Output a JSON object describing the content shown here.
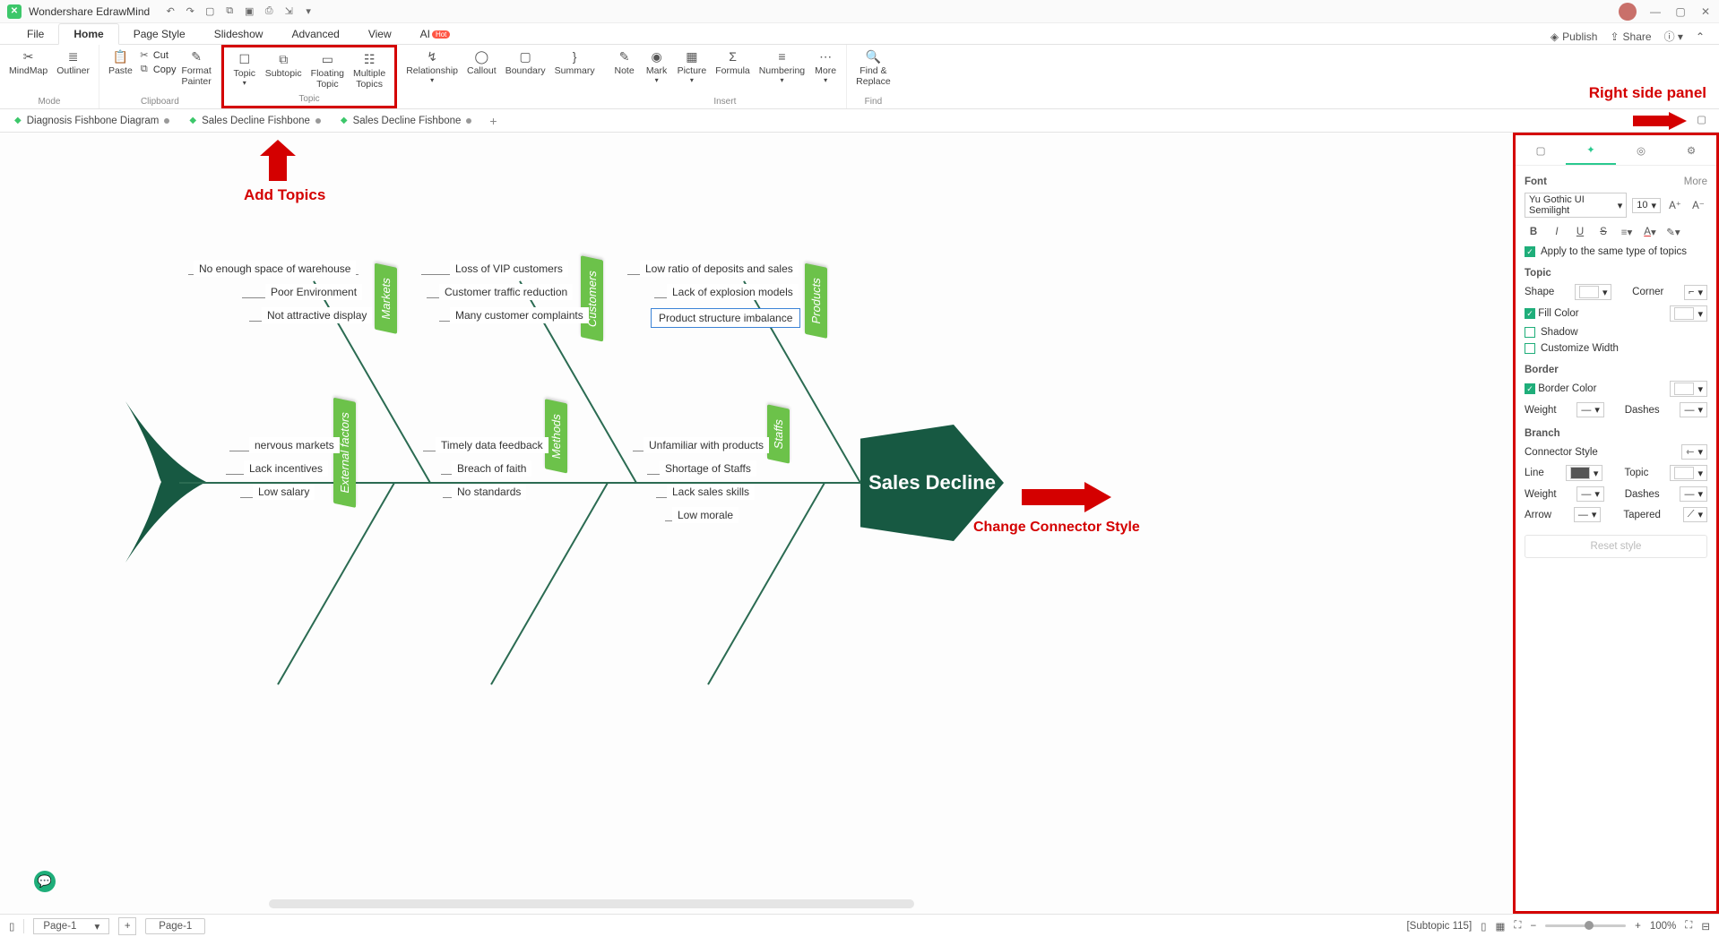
{
  "app": {
    "title": "Wondershare EdrawMind"
  },
  "menubar": {
    "file": "File",
    "home": "Home",
    "pageStyle": "Page Style",
    "slideshow": "Slideshow",
    "advanced": "Advanced",
    "view": "View",
    "ai": "AI",
    "hot": "Hot",
    "publish": "Publish",
    "share": "Share"
  },
  "ribbon": {
    "mode": {
      "mindmap": "MindMap",
      "outliner": "Outliner",
      "label": "Mode"
    },
    "clipboard": {
      "paste": "Paste",
      "cut": "Cut",
      "copy": "Copy",
      "formatPainter": "Format\nPainter",
      "label": "Clipboard"
    },
    "topic": {
      "topic": "Topic",
      "subtopic": "Subtopic",
      "floating": "Floating\nTopic",
      "multiple": "Multiple\nTopics",
      "label": "Topic"
    },
    "other": {
      "relationship": "Relationship",
      "callout": "Callout",
      "boundary": "Boundary",
      "summary": "Summary"
    },
    "insert": {
      "note": "Note",
      "mark": "Mark",
      "picture": "Picture",
      "formula": "Formula",
      "numbering": "Numbering",
      "more": "More",
      "label": "Insert"
    },
    "find": {
      "findReplace": "Find &\nReplace",
      "label": "Find"
    }
  },
  "tabs": {
    "t1": "Diagnosis Fishbone Diagram",
    "t2": "Sales Decline Fishbone",
    "t3": "Sales Decline Fishbone"
  },
  "annotations": {
    "addTopics": "Add Topics",
    "rightPanel": "Right side panel",
    "changeConnector": "Change Connector Style"
  },
  "fishbone": {
    "head": "Sales Decline",
    "bones": {
      "markets": {
        "label": "Markets",
        "items": [
          "No enough space of warehouse",
          "Poor Environment",
          "Not attractive display"
        ]
      },
      "customers": {
        "label": "Customers",
        "items": [
          "Loss of VIP customers",
          "Customer traffic reduction",
          "Many customer complaints"
        ]
      },
      "products": {
        "label": "Products",
        "items": [
          "Low ratio of deposits and sales",
          "Lack of explosion models",
          "Product structure imbalance"
        ]
      },
      "external": {
        "label": "External factors",
        "items": [
          "nervous markets",
          "Lack incentives",
          "Low salary"
        ]
      },
      "methods": {
        "label": "Methods",
        "items": [
          "Timely data feedback",
          "Breach of faith",
          "No standards"
        ]
      },
      "staffs": {
        "label": "Staffs",
        "items": [
          "Unfamiliar with products",
          "Shortage of Staffs",
          "Lack sales skills",
          "Low morale"
        ]
      }
    }
  },
  "sidepanel": {
    "font": {
      "title": "Font",
      "more": "More",
      "family": "Yu Gothic UI Semilight",
      "size": "10",
      "apply": "Apply to the same type of topics"
    },
    "topic": {
      "title": "Topic",
      "shape": "Shape",
      "corner": "Corner",
      "fill": "Fill Color",
      "shadow": "Shadow",
      "customWidth": "Customize Width"
    },
    "border": {
      "title": "Border",
      "color": "Border Color",
      "weight": "Weight",
      "dashes": "Dashes"
    },
    "branch": {
      "title": "Branch",
      "connector": "Connector Style",
      "line": "Line",
      "topic": "Topic",
      "weight": "Weight",
      "dashes": "Dashes",
      "arrow": "Arrow",
      "tapered": "Tapered",
      "reset": "Reset style"
    }
  },
  "statusbar": {
    "pageSel": "Page-1",
    "pageBtn": "Page-1",
    "selInfo": "[Subtopic 115]",
    "zoom": "100%"
  }
}
